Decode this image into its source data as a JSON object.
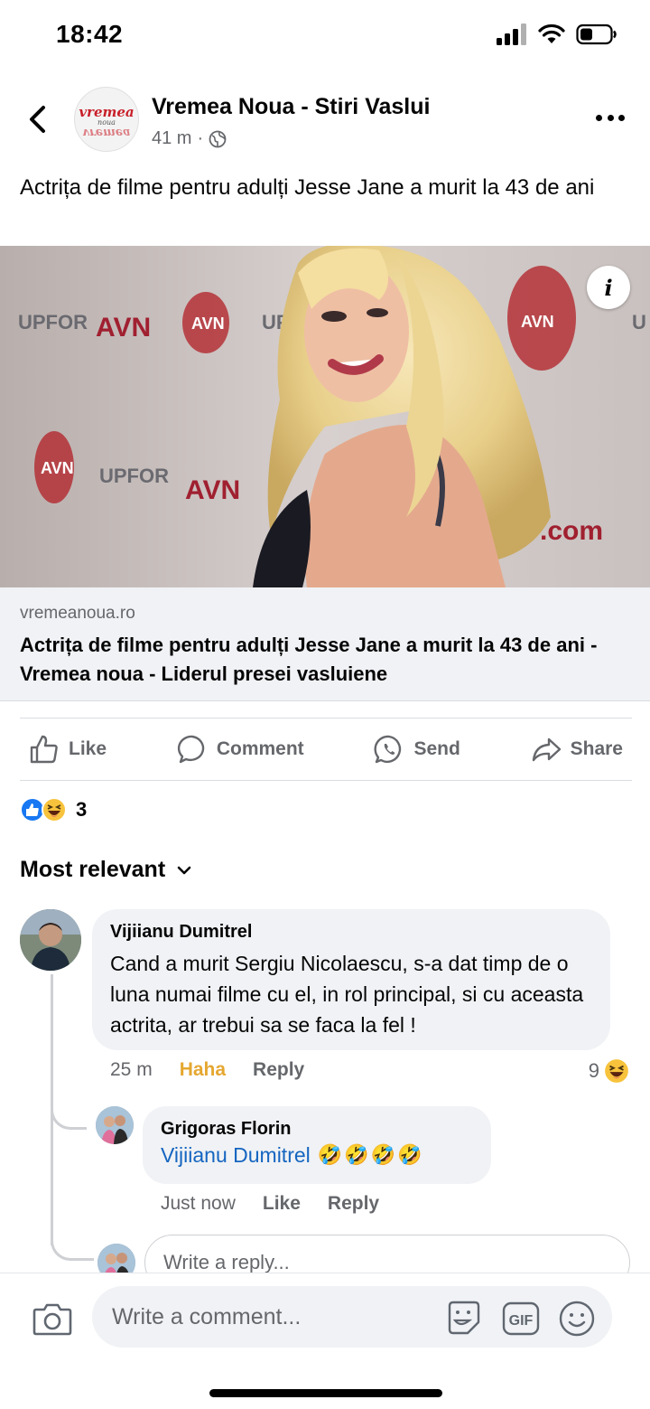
{
  "status_bar": {
    "time": "18:42"
  },
  "post": {
    "page_name": "Vremea Noua - Stiri Vaslui",
    "page_logo": {
      "top": "vremea",
      "mid": "noua",
      "bottom": "vremea"
    },
    "time": "41 m",
    "text": "Actrița de filme pentru adulți Jesse Jane a murit la 43 de ani",
    "image_info": "i"
  },
  "link_preview": {
    "domain": "vremeanoua.ro",
    "title": "Actrița de filme pentru adulți Jesse Jane a murit la 43 de ani - Vremea noua - Liderul presei vasluiene"
  },
  "actions": {
    "like": "Like",
    "comment": "Comment",
    "send": "Send",
    "share": "Share"
  },
  "reactions": {
    "count": "3"
  },
  "sort": {
    "label": "Most relevant"
  },
  "comments": [
    {
      "author": "Vijiianu Dumitrel",
      "text": "Cand a murit Sergiu Nicolaescu, s-a dat timp de o luna numai filme cu el, in rol principal, si cu aceasta actrita, ar trebui sa se faca la fel !",
      "time": "25 m",
      "reaction_action": "Haha",
      "reply": "Reply",
      "reaction_count": "9"
    },
    {
      "author": "Grigoras Florin",
      "mention": "Vijiianu Dumitrel",
      "emoji": "🤣🤣🤣🤣",
      "time": "Just now",
      "like": "Like",
      "reply": "Reply"
    }
  ],
  "reply_input": {
    "placeholder": "Write a reply..."
  },
  "comment_input": {
    "placeholder": "Write a comment..."
  },
  "colors": {
    "accent": "#1877f2",
    "haha": "#e5a730",
    "mention": "#1565c0",
    "muted": "#65676b"
  }
}
